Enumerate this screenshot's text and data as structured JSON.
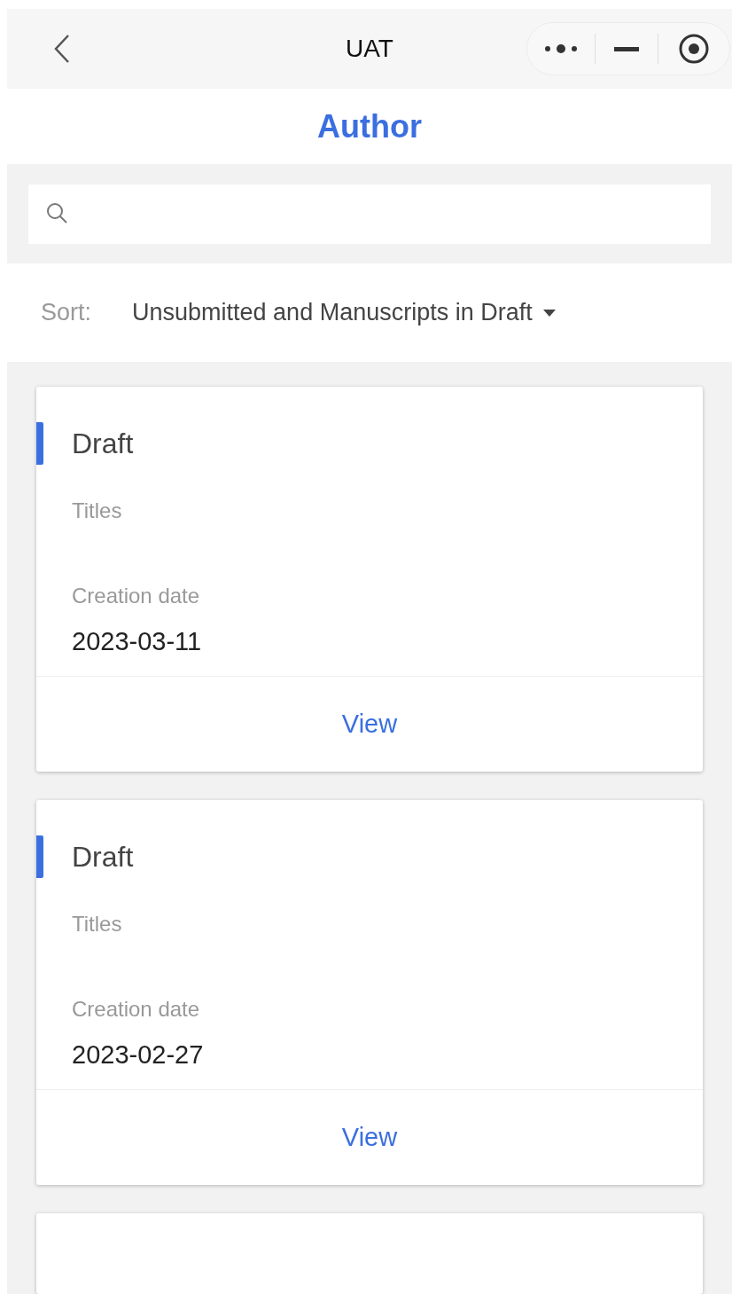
{
  "nav_bar": {
    "title": "UAT"
  },
  "header": {
    "title": "Author"
  },
  "sort": {
    "label": "Sort:",
    "value": "Unsubmitted and Manuscripts in Draft"
  },
  "cards": [
    {
      "status": "Draft",
      "title_label": "Titles",
      "date_label": "Creation date",
      "date": "2023-03-11",
      "action": "View"
    },
    {
      "status": "Draft",
      "title_label": "Titles",
      "date_label": "Creation date",
      "date": "2023-02-27",
      "action": "View"
    }
  ]
}
